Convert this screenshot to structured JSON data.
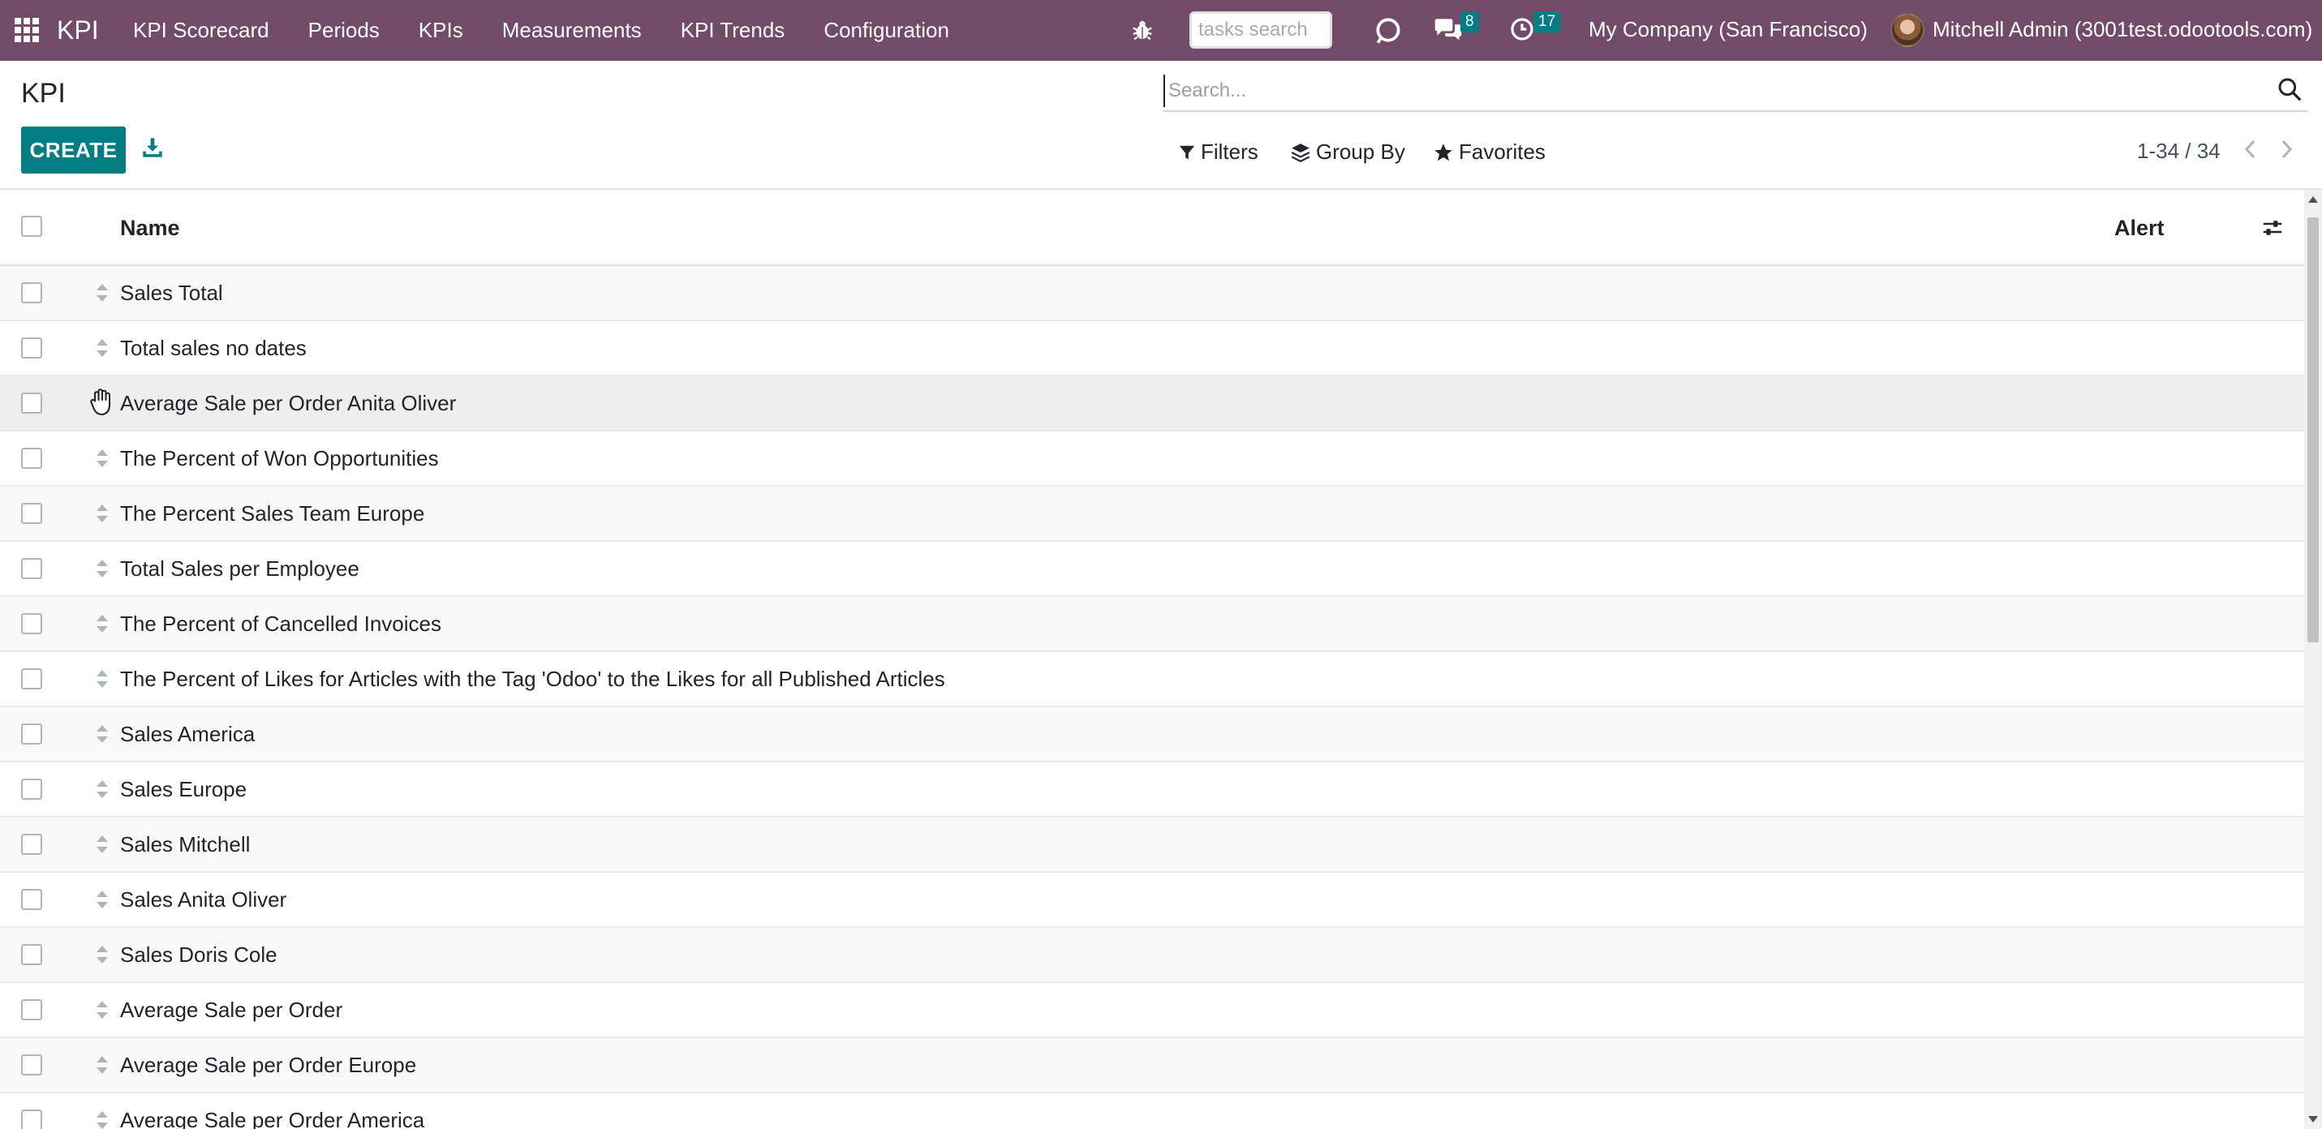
{
  "navbar": {
    "app_name": "KPI",
    "menu": [
      "KPI Scorecard",
      "Periods",
      "KPIs",
      "Measurements",
      "KPI Trends",
      "Configuration"
    ],
    "tasks_search_placeholder": "tasks search",
    "messages_count": "8",
    "activities_count": "17",
    "company": "My Company (San Francisco)",
    "user": "Mitchell Admin (3001test.odootools.com)",
    "colors": {
      "brand": "#714b67",
      "badge": "#017e84"
    }
  },
  "control_panel": {
    "breadcrumb": "KPI",
    "create_label": "CREATE",
    "search_placeholder": "Search...",
    "filters_label": "Filters",
    "groupby_label": "Group By",
    "favorites_label": "Favorites",
    "pager": "1-34 / 34",
    "colors": {
      "primary": "#017e84"
    }
  },
  "list": {
    "columns": {
      "name": "Name",
      "alert": "Alert"
    },
    "rows": [
      "Sales Total",
      "Total sales no dates",
      "Average Sale per Order Anita Oliver",
      "The Percent of Won Opportunities",
      "The Percent Sales Team Europe",
      "Total Sales per Employee",
      "The Percent of Cancelled Invoices",
      "The Percent of Likes for Articles with the Tag 'Odoo' to the Likes for all Published Articles",
      "Sales America",
      "Sales Europe",
      "Sales Mitchell",
      "Sales Anita Oliver",
      "Sales Doris Cole",
      "Average Sale per Order",
      "Average Sale per Order Europe",
      "Average Sale per Order America"
    ],
    "hovered_row": 2
  }
}
